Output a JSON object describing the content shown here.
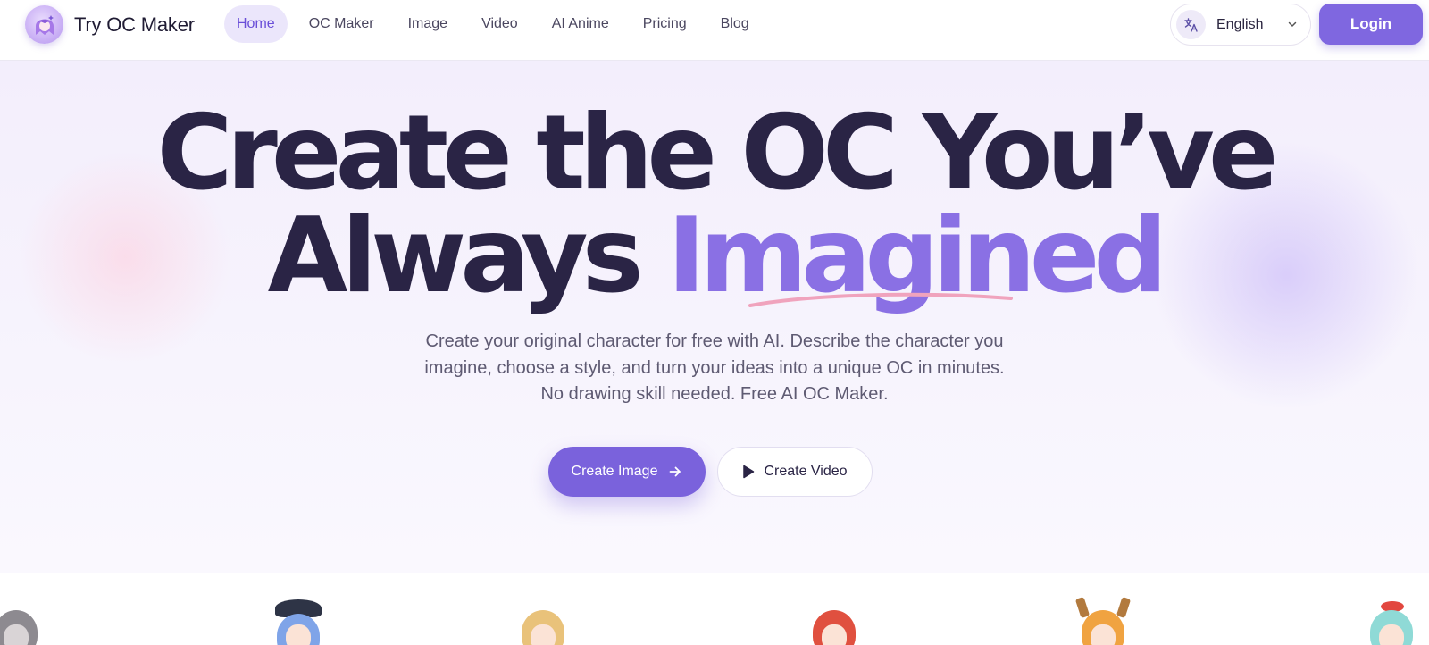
{
  "nav": {
    "brand": "Try OC Maker",
    "links": [
      {
        "label": "Home",
        "active": true
      },
      {
        "label": "OC Maker",
        "active": false
      },
      {
        "label": "Image",
        "active": false
      },
      {
        "label": "Video",
        "active": false
      },
      {
        "label": "AI Anime",
        "active": false
      },
      {
        "label": "Pricing",
        "active": false
      },
      {
        "label": "Blog",
        "active": false
      }
    ],
    "language": "English",
    "login": "Login"
  },
  "hero": {
    "headline_line1": "Create the OC You’ve",
    "headline_line2_plain": "Always ",
    "headline_line2_accent": "Imagined",
    "subtitle": "Create your original character for free with AI. Describe the character you imagine, choose a style, and turn your ideas into a unique OC in minutes. No drawing skill needed. Free AI OC Maker.",
    "cta_primary": "Create Image",
    "cta_secondary": "Create Video"
  },
  "icons": {
    "logo": "anime-girl-avatar-icon",
    "language": "translate-icon",
    "chevron": "chevron-down-icon",
    "arrow": "arrow-right-icon",
    "play": "play-icon"
  },
  "colors": {
    "brand": "#7f67e0",
    "accent_text": "#8a70e4",
    "headline": "#2a2445",
    "underline": "#f0a3bd"
  }
}
